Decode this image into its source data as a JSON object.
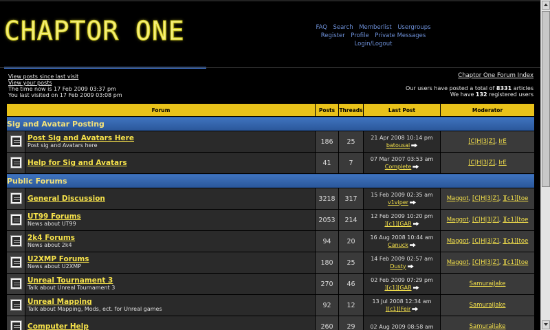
{
  "header": {
    "logo_text": "CHAPTOR ONE",
    "nav_row1": [
      "FAQ",
      "Search",
      "Memberlist",
      "Usergroups"
    ],
    "nav_row2": [
      "Register",
      "Profile",
      "Private Messages"
    ],
    "nav_row3": [
      "Login/Logout"
    ]
  },
  "info": {
    "view_since_last": "View posts since last visit",
    "view_your_posts": "View your posts",
    "time_now": "The time now is 17 Feb 2009 03:37 pm",
    "last_visited": "You last visited on 17 Feb 2009 03:08 pm",
    "index_link": "Chaptor One Forum Index",
    "articles_prefix": "Our users have posted a total of ",
    "articles_count": "8331",
    "articles_suffix": " articles",
    "users_prefix": "We have ",
    "users_count": "132",
    "users_suffix": " registered users"
  },
  "table": {
    "headers": {
      "forum": "Forum",
      "posts": "Posts",
      "threads": "Threads",
      "last_post": "Last Post",
      "moderator": "Moderator"
    }
  },
  "categories": [
    {
      "name": "Sig and Avatar Posting",
      "forums": [
        {
          "name": "Post Sig and Avatars Here",
          "desc": "Post sig and Avatars here",
          "posts": "186",
          "threads": "25",
          "last_date": "21 Apr 2008 10:14 pm",
          "last_user": "batousai",
          "mods": [
            "[C|H|3|Z]",
            "IrE"
          ]
        },
        {
          "name": "Help for Sig and Avatars",
          "desc": "",
          "posts": "41",
          "threads": "7",
          "last_date": "07 Mar 2007 03:53 am",
          "last_user": "Complete",
          "mods": [
            "[C|H|3|Z]",
            "IrE"
          ]
        }
      ]
    },
    {
      "name": "Public Forums",
      "forums": [
        {
          "name": "General Discussion",
          "desc": "",
          "posts": "3218",
          "threads": "317",
          "last_date": "15 Feb 2009 02:35 am",
          "last_user": "v1viper",
          "mods": [
            "Maggot",
            "[C|H|3|Z]",
            "][c1][toe"
          ]
        },
        {
          "name": "UT99 Forums",
          "desc": "News about UT99",
          "posts": "2053",
          "threads": "214",
          "last_date": "12 Feb 2009 10:20 pm",
          "last_user": "][c1][GAB",
          "mods": [
            "Maggot",
            "[C|H|3|Z]",
            "][c1][toe"
          ]
        },
        {
          "name": "2k4 Forums",
          "desc": "News about 2k4",
          "posts": "94",
          "threads": "20",
          "last_date": "16 Aug 2008 10:44 am",
          "last_user": "Canuck",
          "mods": [
            "Maggot",
            "[C|H|3|Z]",
            "][c1][toe"
          ]
        },
        {
          "name": "U2XMP Forums",
          "desc": "News about U2XMP",
          "posts": "180",
          "threads": "25",
          "last_date": "14 Feb 2009 02:57 am",
          "last_user": "Dusty",
          "mods": [
            "Maggot",
            "[C|H|3|Z]",
            "][c1][toe"
          ]
        },
        {
          "name": "Unreal Tournament 3",
          "desc": "Talk about Unreal Tournament 3",
          "posts": "270",
          "threads": "46",
          "last_date": "02 Feb 2009 07:29 pm",
          "last_user": "][c1][GAB",
          "mods": [
            "SamuraiJake"
          ]
        },
        {
          "name": "Unreal Mapping",
          "desc": "Talk about Mapping, Mods, ect. for Unreal games",
          "posts": "92",
          "threads": "12",
          "last_date": "13 Jul 2008 12:34 am",
          "last_user": "][c1][Feir",
          "mods": [
            "SamuraiJake"
          ]
        },
        {
          "name": "Computer Help",
          "desc": "",
          "posts": "260",
          "threads": "29",
          "last_date": "02 Aug 2009 08:58 am",
          "last_user": "",
          "mods": [
            "SamuraiJake"
          ]
        }
      ]
    }
  ]
}
